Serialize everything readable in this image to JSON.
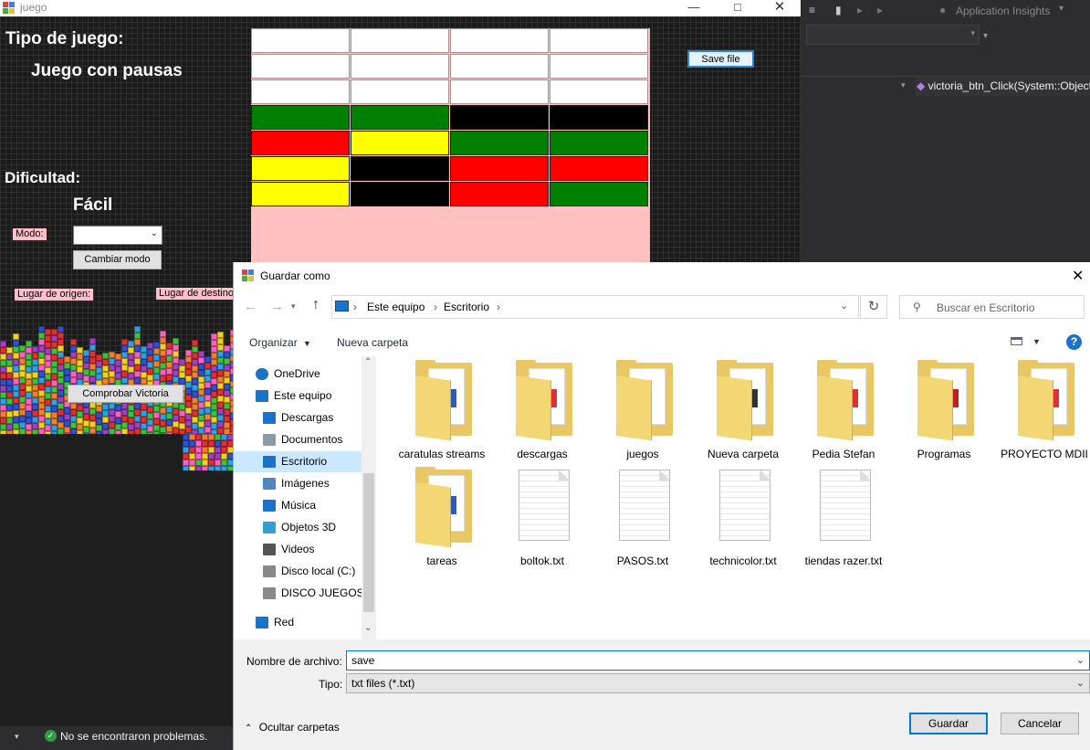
{
  "game_window": {
    "title": "juego",
    "labels": {
      "tipo_title": "Tipo de juego:",
      "tipo_value": "Juego con pausas",
      "dificultad_title": "Dificultad:",
      "dificultad_value": "Fácil",
      "modo": "Modo:",
      "origen": "Lugar de origen:",
      "destino": "Lugar de destino"
    },
    "buttons": {
      "cambiar_modo": "Cambiar modo",
      "comprobar": "Comprobar Victoria",
      "save_file": "Save file"
    },
    "modo_select_value": "",
    "grid_rows": [
      [
        "white",
        "white",
        "white",
        "white"
      ],
      [
        "white",
        "white",
        "white",
        "white"
      ],
      [
        "white",
        "white",
        "white",
        "white"
      ],
      [
        "green",
        "green",
        "black",
        "black"
      ],
      [
        "red",
        "yellow",
        "green",
        "green"
      ],
      [
        "yellow",
        "black",
        "red",
        "red"
      ],
      [
        "yellow",
        "black",
        "red",
        "green"
      ]
    ],
    "colors": {
      "white": "#ffffff",
      "green": "#008000",
      "black": "#000000",
      "red": "#ff0000",
      "yellow": "#ffff00",
      "pink": "#ffc0c0"
    }
  },
  "vs": {
    "toolbar_text": "Application Insights",
    "method_combo": "victoria_btn_Click(System::Object",
    "status": "No se encontraron problemas."
  },
  "dialog": {
    "title": "Guardar como",
    "breadcrumb": [
      "Este equipo",
      "Escritorio"
    ],
    "search_placeholder": "Buscar en Escritorio",
    "toolbar": {
      "organizar": "Organizar",
      "nueva_carpeta": "Nueva carpeta"
    },
    "nav_items": [
      {
        "label": "OneDrive",
        "icon": "cloud-icon",
        "indent": 1
      },
      {
        "label": "Este equipo",
        "icon": "computer-icon",
        "indent": 1
      },
      {
        "label": "Descargas",
        "icon": "download-icon",
        "indent": 2
      },
      {
        "label": "Documentos",
        "icon": "document-icon",
        "indent": 2
      },
      {
        "label": "Escritorio",
        "icon": "desktop-icon",
        "indent": 2,
        "selected": true
      },
      {
        "label": "Imágenes",
        "icon": "pictures-icon",
        "indent": 2
      },
      {
        "label": "Música",
        "icon": "music-icon",
        "indent": 2
      },
      {
        "label": "Objetos 3D",
        "icon": "cube-icon",
        "indent": 2
      },
      {
        "label": "Videos",
        "icon": "video-icon",
        "indent": 2
      },
      {
        "label": "Disco local (C:)",
        "icon": "drive-icon",
        "indent": 2
      },
      {
        "label": "DISCO JUEGOS (",
        "icon": "drive-icon",
        "indent": 2
      },
      {
        "label": "Red",
        "icon": "network-icon",
        "indent": 1
      }
    ],
    "files": [
      {
        "name": "caratulas streams",
        "kind": "folder"
      },
      {
        "name": "descargas",
        "kind": "folder"
      },
      {
        "name": "juegos",
        "kind": "folder"
      },
      {
        "name": "Nueva carpeta",
        "kind": "folder"
      },
      {
        "name": "Pedia Stefan",
        "kind": "folder"
      },
      {
        "name": "Programas",
        "kind": "folder"
      },
      {
        "name": "PROYECTO MDII",
        "kind": "folder"
      },
      {
        "name": "tareas",
        "kind": "folder"
      },
      {
        "name": "boltok.txt",
        "kind": "txt"
      },
      {
        "name": "PASOS.txt",
        "kind": "txt"
      },
      {
        "name": "technicolor.txt",
        "kind": "txt"
      },
      {
        "name": "tiendas razer.txt",
        "kind": "txt"
      }
    ],
    "filename_label": "Nombre de archivo:",
    "filename_value": "save",
    "type_label": "Tipo:",
    "type_value": "txt files (*.txt)",
    "hide_folders": "Ocultar carpetas",
    "save_button": "Guardar",
    "cancel_button": "Cancelar"
  }
}
